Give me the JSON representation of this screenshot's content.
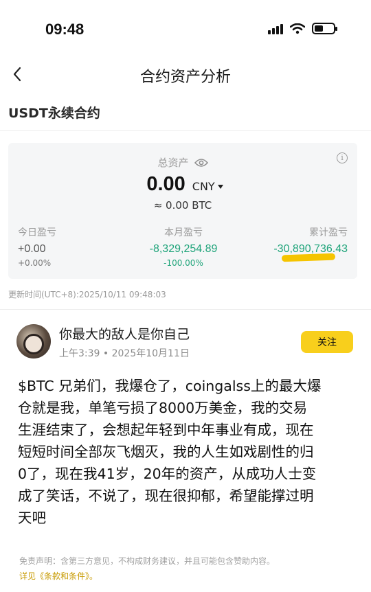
{
  "status_bar": {
    "time": "09:48"
  },
  "nav": {
    "title": "合约资产分析"
  },
  "section": {
    "label": "USDT永续合约"
  },
  "assets": {
    "total_label": "总资产",
    "total_value": "0.00",
    "currency": "CNY",
    "btc_equiv": "≈ 0.00 BTC",
    "today": {
      "label": "今日盈亏",
      "value": "+0.00",
      "pct": "+0.00%"
    },
    "month": {
      "label": "本月盈亏",
      "value": "-8,329,254.89",
      "pct": "-100.00%"
    },
    "cumulative": {
      "label": "累计盈亏",
      "value": "-30,890,736.43"
    },
    "update_time": "更新时间(UTC+8):2025/10/11 09:48:03"
  },
  "post": {
    "author": "你最大的敌人是你自己",
    "time": "上午3:39 • 2025年10月11日",
    "follow_label": "关注",
    "lines": [
      "$BTC 兄弟们，我爆仓了，coingalss上的最大爆",
      "仓就是我，单笔亏损了8000万美金，我的交易",
      "生涯结束了，会想起年轻到中年事业有成，现在",
      "短短时间全部灰飞烟灭，我的人生如戏剧性的归",
      "0了，现在我41岁，20年的资产，从成功人士变",
      "成了笑话，不说了，现在很抑郁，希望能撑过明",
      "天吧"
    ]
  },
  "footer": {
    "disclaimer": "免责声明：含第三方意见，不构成财务建议，并且可能包含赞助内容。",
    "terms": "详见《条款和条件》。"
  },
  "colors": {
    "profit_green": "#1fa47a",
    "accent_yellow": "#f8cf1c"
  },
  "icons": [
    "back-chevron-icon",
    "eye-icon",
    "info-icon",
    "signal-icon",
    "wifi-icon",
    "battery-icon",
    "caret-down-icon"
  ]
}
